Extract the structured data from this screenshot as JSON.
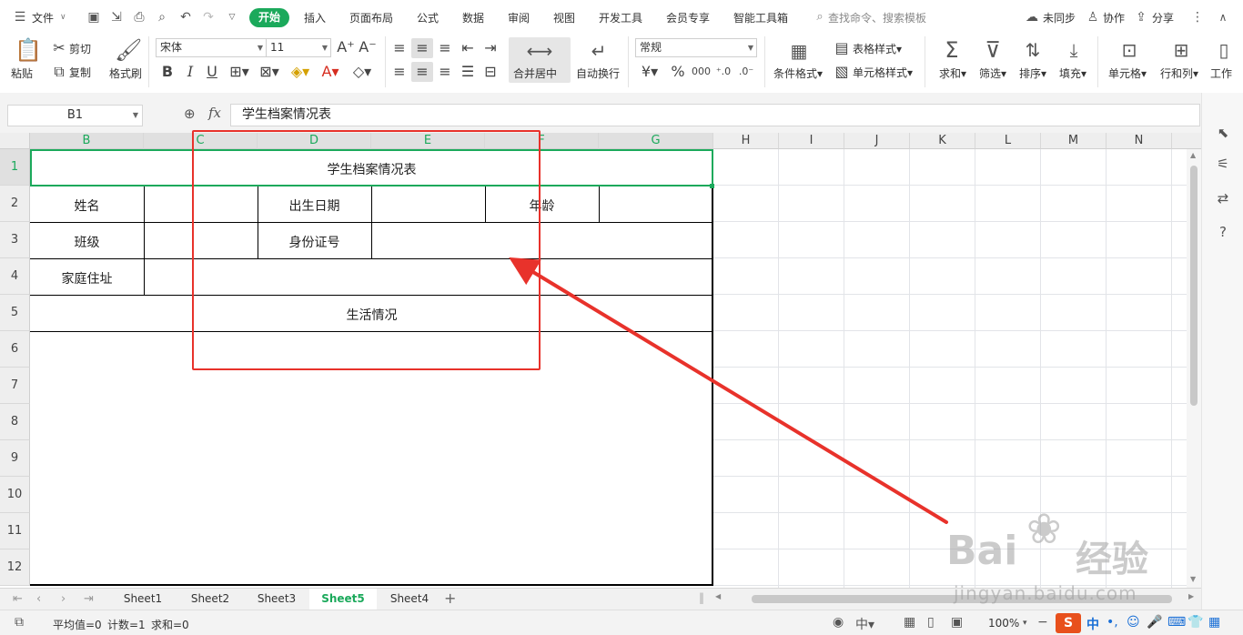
{
  "menubar": {
    "file_label": "文件",
    "tabs": [
      "开始",
      "插入",
      "页面布局",
      "公式",
      "数据",
      "审阅",
      "视图",
      "开发工具",
      "会员专享",
      "智能工具箱"
    ],
    "search_placeholder": "查找命令、搜索模板",
    "sync_label": "未同步",
    "collab_label": "协作",
    "share_label": "分享"
  },
  "ribbon": {
    "paste": "粘贴",
    "cut": "剪切",
    "copy": "复制",
    "format_painter": "格式刷",
    "font_name": "宋体",
    "font_size": "11",
    "merge_center": "合并居中",
    "wrap_text": "自动换行",
    "number_format": "常规",
    "conditional_format": "条件格式",
    "table_style": "表格样式",
    "cell_style": "单元格样式",
    "sum": "求和",
    "filter": "筛选",
    "sort": "排序",
    "fill": "填充",
    "cell": "单元格",
    "row_col": "行和列",
    "worksheet": "工作"
  },
  "formula_bar": {
    "name_box": "B1",
    "fx": "fx",
    "content": "学生档案情况表"
  },
  "grid": {
    "columns": [
      "B",
      "C",
      "D",
      "E",
      "F",
      "G",
      "H",
      "I",
      "J",
      "K",
      "L",
      "M",
      "N"
    ],
    "rows": [
      "1",
      "2",
      "3",
      "4",
      "5",
      "6",
      "7",
      "8",
      "9",
      "10",
      "11",
      "12"
    ],
    "cells": {
      "title": "学生档案情况表",
      "name": "姓名",
      "birth": "出生日期",
      "age": "年龄",
      "class": "班级",
      "id_number": "身份证号",
      "address": "家庭住址",
      "life": "生活情况"
    }
  },
  "sheets": {
    "tabs": [
      "Sheet1",
      "Sheet2",
      "Sheet3",
      "Sheet5",
      "Sheet4"
    ],
    "active": "Sheet5"
  },
  "statusbar": {
    "average": "平均值=0",
    "count": "计数=1",
    "sum": "求和=0",
    "zoom": "100%"
  },
  "watermark": {
    "brand": "Bai",
    "brand_tail": "经验",
    "url": "jingyan.baidu.com"
  },
  "colors": {
    "accent": "#1ba95b",
    "annotation": "#e8322b"
  }
}
